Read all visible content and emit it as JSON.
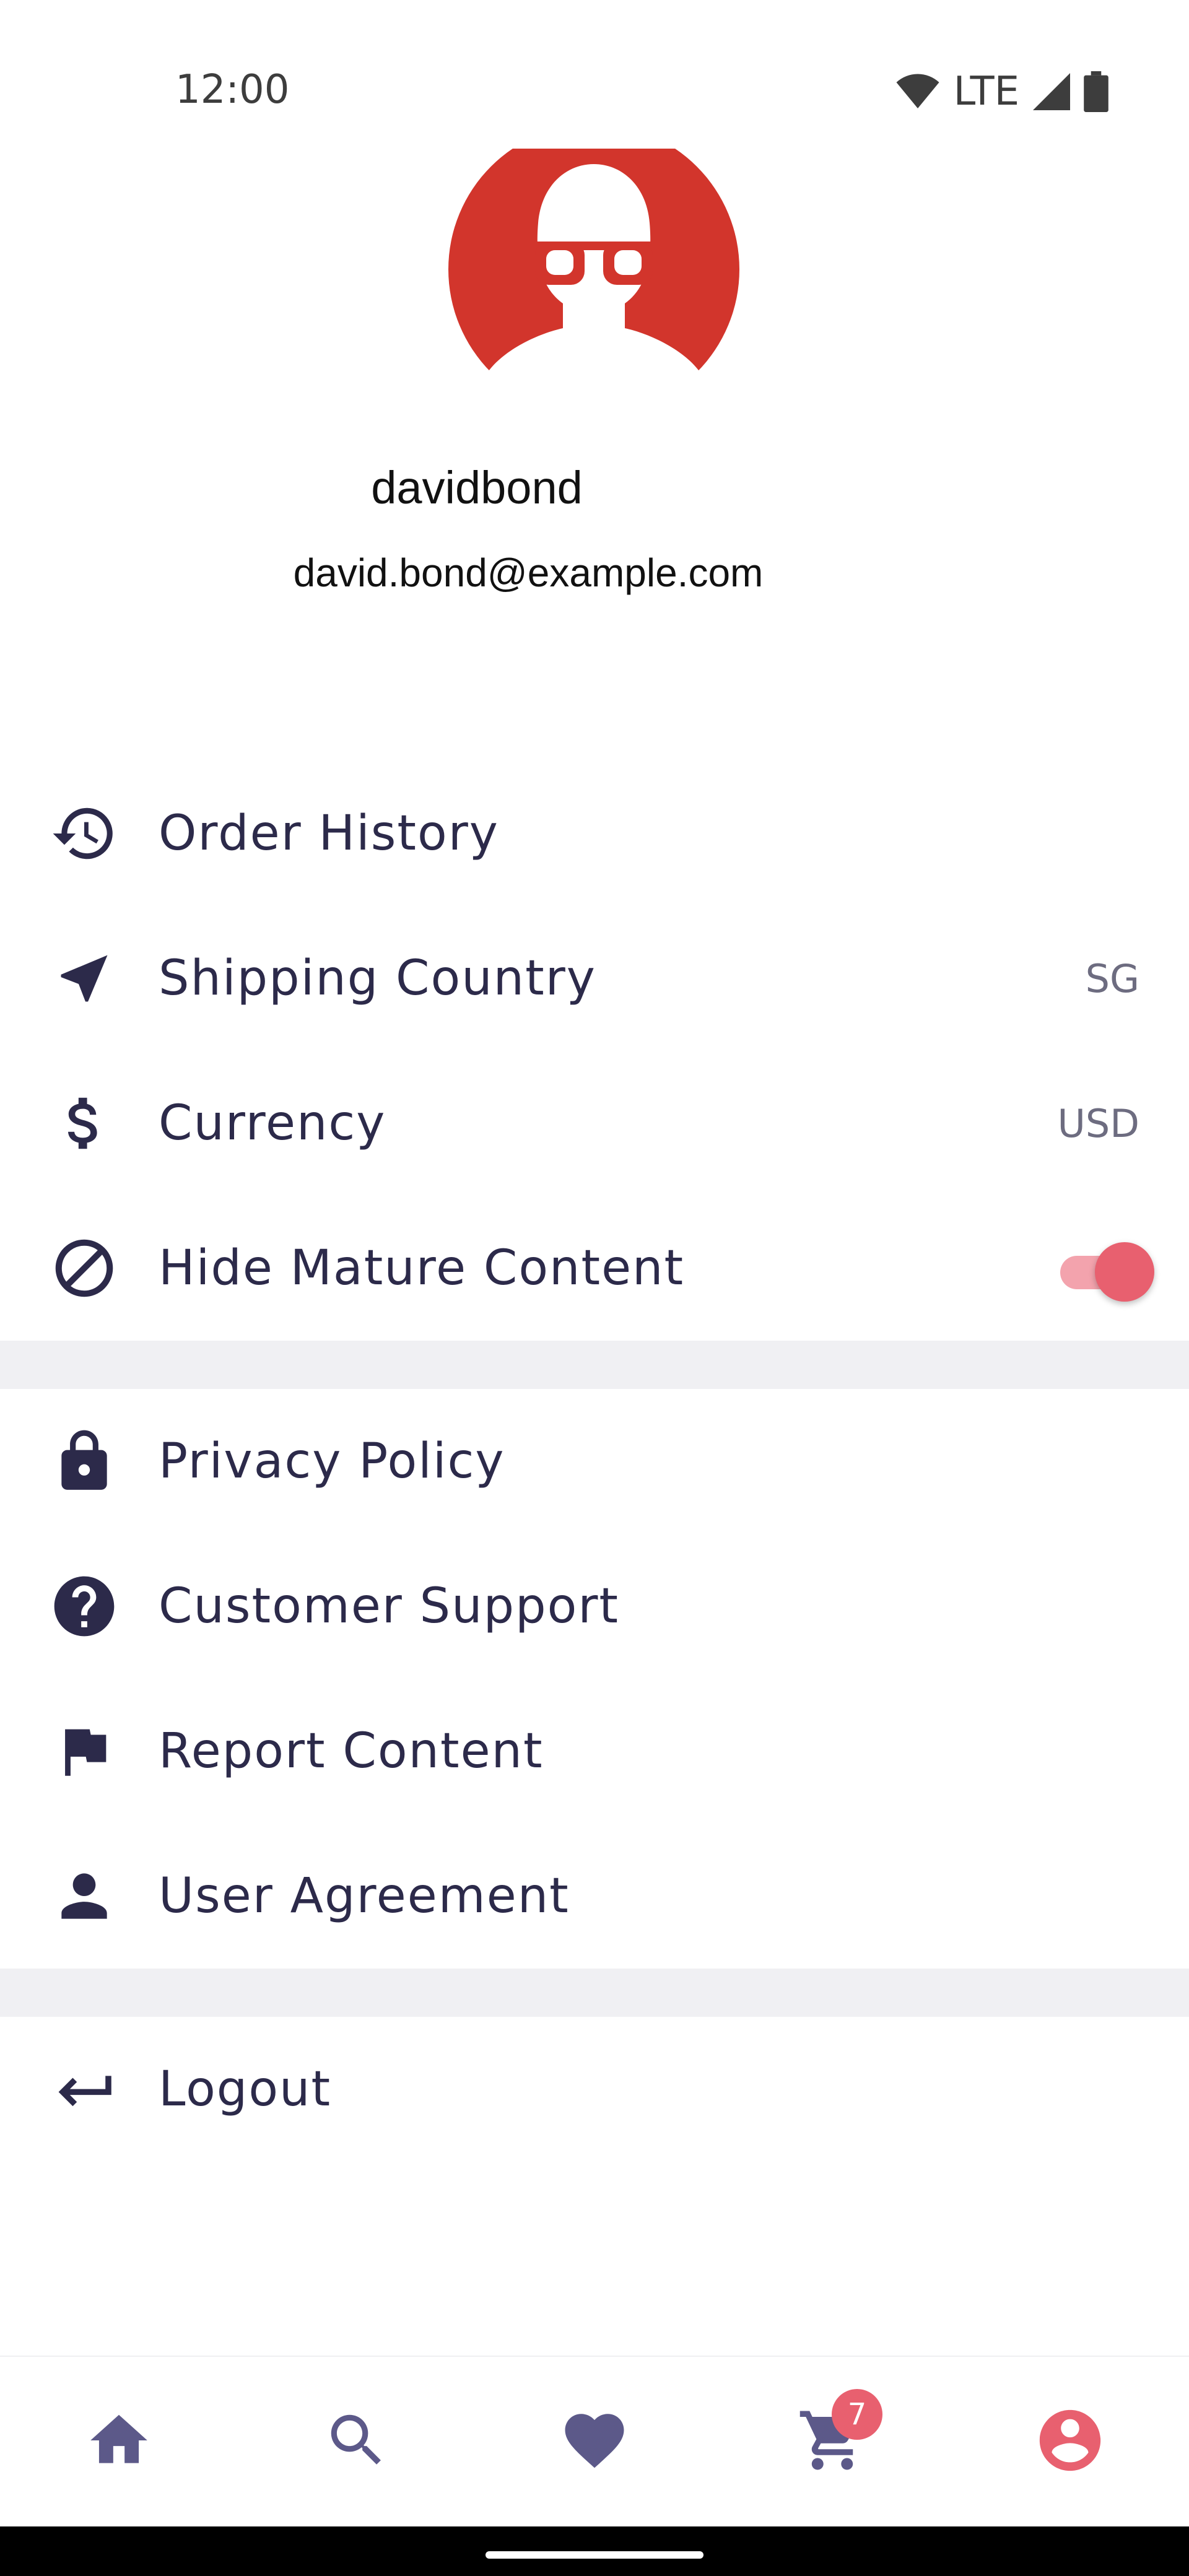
{
  "status_bar": {
    "time": "12:00",
    "network": "LTE",
    "icons": [
      "wifi-icon",
      "cell-signal-icon",
      "battery-icon"
    ]
  },
  "profile": {
    "username": "davidbond",
    "email": "david.bond@example.com",
    "avatar_color": "#d2352c"
  },
  "menu_group_1": [
    {
      "label": "Order History",
      "icon": "history-icon"
    },
    {
      "label": "Shipping Country",
      "icon": "navigation-icon",
      "value": "SG"
    },
    {
      "label": "Currency",
      "icon": "dollar-icon",
      "value": "USD"
    },
    {
      "label": "Hide Mature Content",
      "icon": "block-icon",
      "toggle_on": true
    }
  ],
  "menu_group_2": [
    {
      "label": "Privacy Policy",
      "icon": "lock-icon"
    },
    {
      "label": "Customer Support",
      "icon": "help-icon"
    },
    {
      "label": "Report Content",
      "icon": "flag-icon"
    },
    {
      "label": "User Agreement",
      "icon": "person-icon"
    }
  ],
  "menu_group_3": [
    {
      "label": "Logout",
      "icon": "logout-icon"
    }
  ],
  "bottom_nav": {
    "items": [
      "home-icon",
      "search-icon",
      "heart-icon",
      "cart-icon",
      "account-icon"
    ],
    "active": "account-icon",
    "cart_badge": "7"
  },
  "colors": {
    "text_primary": "#2c2a4a",
    "accent": "#e8606f",
    "nav_icon": "#5c5989",
    "divider": "#f0f0f3"
  }
}
